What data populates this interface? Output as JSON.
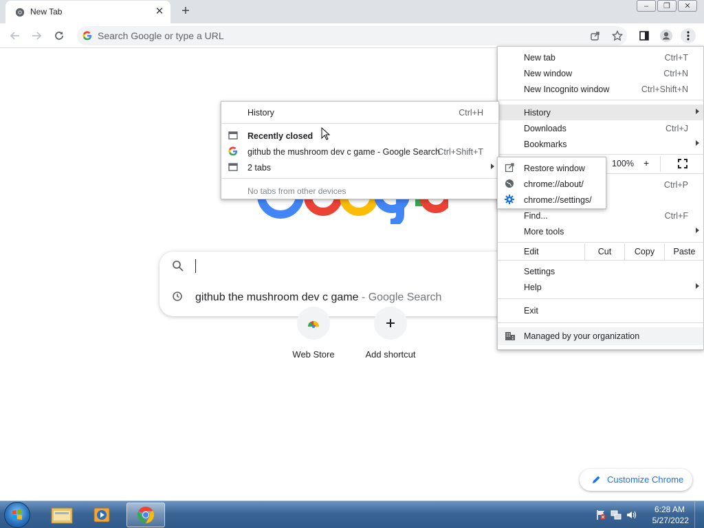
{
  "tab": {
    "title": "New Tab",
    "close_glyph": "✕",
    "new_tab_glyph": "+"
  },
  "window_controls": {
    "minimize": "‒",
    "restore": "❐",
    "close": "✕"
  },
  "omnibox": {
    "placeholder": "Search Google or type a URL"
  },
  "searchbox": {
    "suggestion_query": "github the mushroom dev c game",
    "suggestion_suffix": " - Google Search"
  },
  "shortcuts": [
    {
      "label": "Web Store",
      "icon": "web-store-icon"
    },
    {
      "label": "Add shortcut",
      "icon": "plus-icon"
    }
  ],
  "customize": {
    "label": "Customize Chrome"
  },
  "main_menu": {
    "new_tab": {
      "label": "New tab",
      "accel": "Ctrl+T"
    },
    "new_window": {
      "label": "New window",
      "accel": "Ctrl+N"
    },
    "new_incognito": {
      "label": "New Incognito window",
      "accel": "Ctrl+Shift+N"
    },
    "history": {
      "label": "History"
    },
    "downloads": {
      "label": "Downloads",
      "accel": "Ctrl+J"
    },
    "bookmarks": {
      "label": "Bookmarks"
    },
    "zoom": {
      "value": "100%",
      "plus": "+"
    },
    "print_accel": "Ctrl+P",
    "find": {
      "label": "Find...",
      "accel": "Ctrl+F"
    },
    "more_tools": {
      "label": "More tools"
    },
    "edit": {
      "label": "Edit",
      "cut": "Cut",
      "copy": "Copy",
      "paste": "Paste"
    },
    "settings": {
      "label": "Settings"
    },
    "help": {
      "label": "Help"
    },
    "exit": {
      "label": "Exit"
    },
    "managed": {
      "label": "Managed by your organization"
    }
  },
  "history_menu": {
    "history": {
      "label": "History",
      "accel": "Ctrl+H"
    },
    "recently_closed": {
      "label": "Recently closed"
    },
    "closed_page": {
      "label": "github the mushroom dev c game - Google Search",
      "accel": "Ctrl+Shift+T"
    },
    "two_tabs": {
      "label": "2 tabs"
    },
    "no_tabs": {
      "label": "No tabs from other devices"
    }
  },
  "history_submenu": {
    "restore": {
      "label": "Restore window"
    },
    "about": {
      "label": "chrome://about/"
    },
    "settings": {
      "label": "chrome://settings/"
    }
  },
  "taskbar": {
    "time": "6:28 AM",
    "date": "5/27/2022"
  },
  "colors": {
    "accent": "#1a73e8",
    "google_blue": "#4285f4",
    "google_red": "#ea4335",
    "google_yellow": "#fbbc05",
    "google_green": "#34a853"
  }
}
